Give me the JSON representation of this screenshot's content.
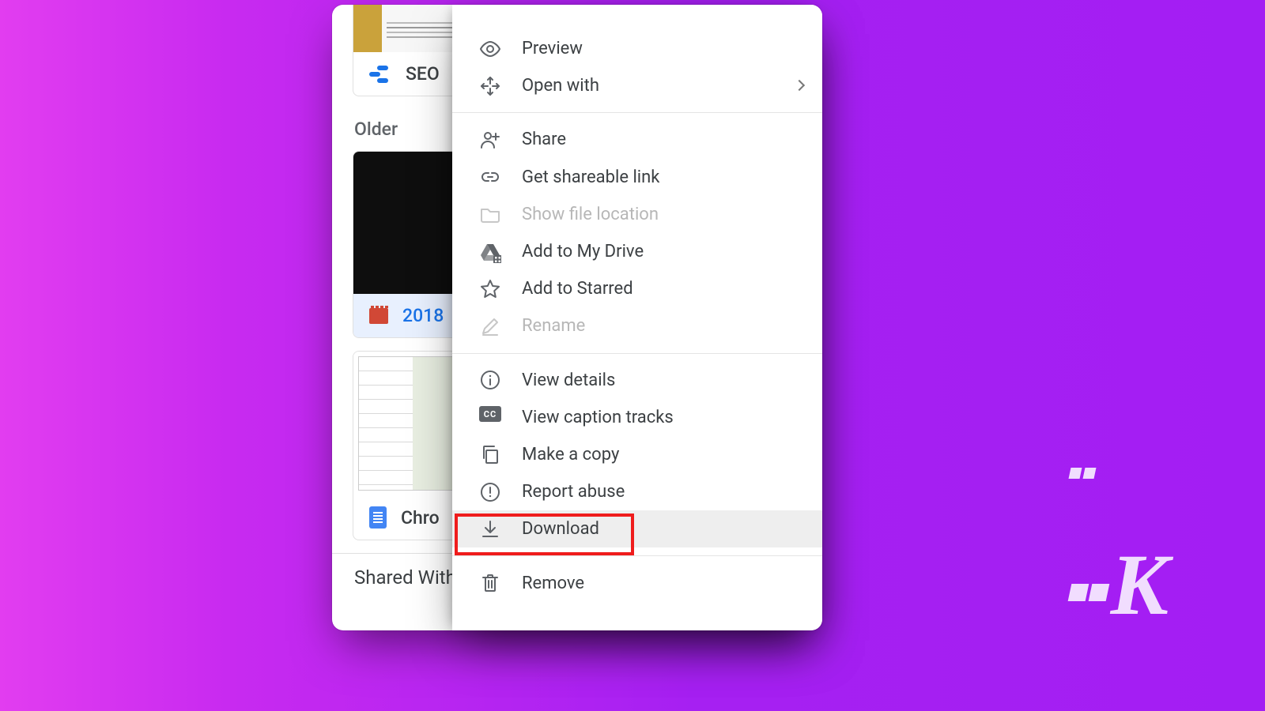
{
  "panel": {
    "tile1_label": "SEO",
    "section_header": "Older",
    "tile2_label": "2018",
    "tile3_label": "Chro",
    "footer": "Shared With M"
  },
  "menu": {
    "preview": "Preview",
    "open_with": "Open with",
    "share": "Share",
    "get_link": "Get shareable link",
    "show_location": "Show file location",
    "add_drive": "Add to My Drive",
    "add_starred": "Add to Starred",
    "rename": "Rename",
    "view_details": "View details",
    "view_captions": "View caption tracks",
    "make_copy": "Make a copy",
    "report_abuse": "Report abuse",
    "download": "Download",
    "remove": "Remove",
    "cc_badge": "CC"
  },
  "watermark": "K"
}
